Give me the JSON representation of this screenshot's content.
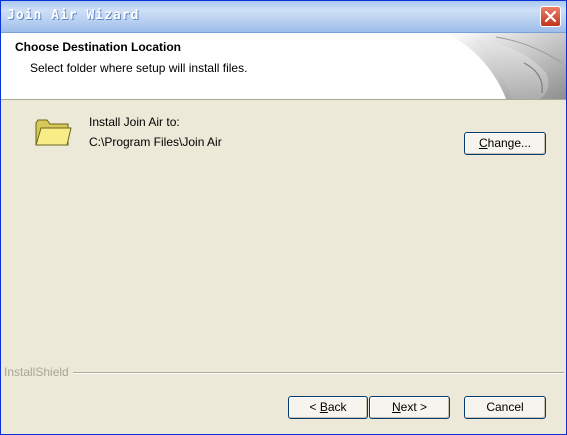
{
  "window": {
    "title": "Join Air Wizard"
  },
  "header": {
    "title": "Choose Destination Location",
    "subtitle": "Select folder where setup will install files."
  },
  "install": {
    "label": "Install Join Air to:",
    "path": "C:\\Program Files\\Join Air",
    "change_label_pre": "",
    "change_label_accel": "C",
    "change_label_post": "hange..."
  },
  "footer": {
    "brand": "InstallShield",
    "back_pre": "< ",
    "back_accel": "B",
    "back_post": "ack",
    "next_accel": "N",
    "next_post": "ext >",
    "cancel_label": "Cancel"
  },
  "icons": {
    "close": "close-icon",
    "folder": "folder-icon"
  },
  "colors": {
    "dialog_bg": "#ece9d8",
    "titlebar": "#b7cff0",
    "close_button": "#c1351c",
    "button_border": "#003c74"
  }
}
